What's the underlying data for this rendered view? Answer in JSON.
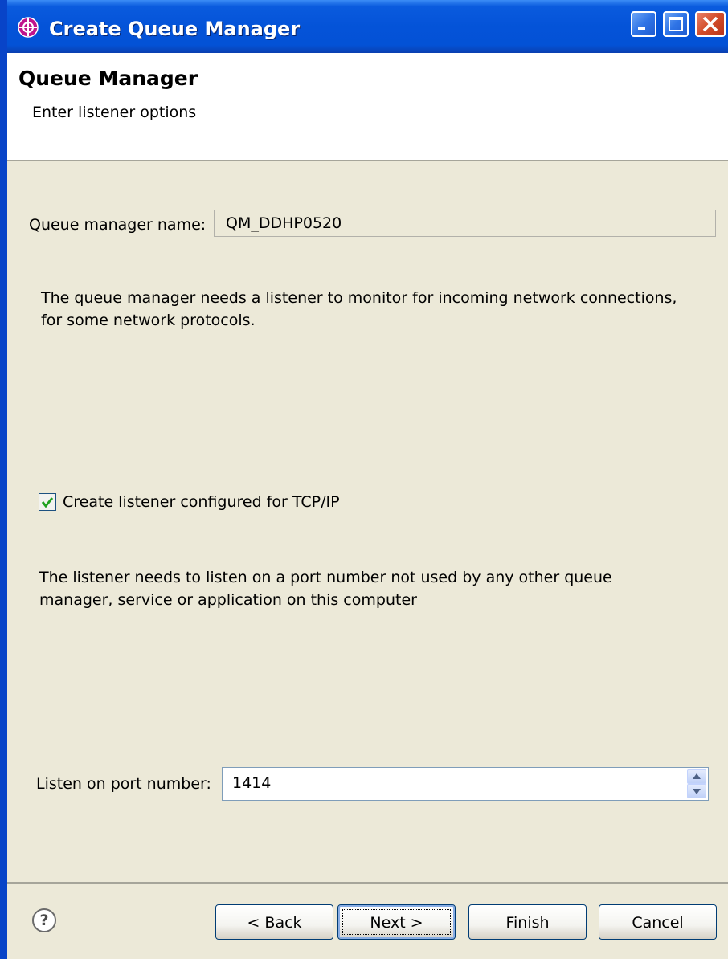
{
  "window": {
    "title": "Create Queue Manager"
  },
  "header": {
    "title": "Queue Manager",
    "subtitle": "Enter listener options"
  },
  "queue_manager": {
    "label": "Queue manager name:",
    "value": "QM_DDHP0520"
  },
  "listener_info": "The queue manager needs a listener to monitor for incoming network connections, for some network protocols.",
  "tcp_checkbox": {
    "label": "Create listener configured for TCP/IP",
    "checked": true
  },
  "port_info": "The listener needs to listen on a port number not used by any other queue manager, service or application on this computer",
  "port": {
    "label": "Listen on port number:",
    "value": "1414"
  },
  "buttons": {
    "back": "< Back",
    "next": "Next >",
    "finish": "Finish",
    "cancel": "Cancel"
  },
  "icons": {
    "app": "queue-manager-icon",
    "help": "help-icon"
  }
}
